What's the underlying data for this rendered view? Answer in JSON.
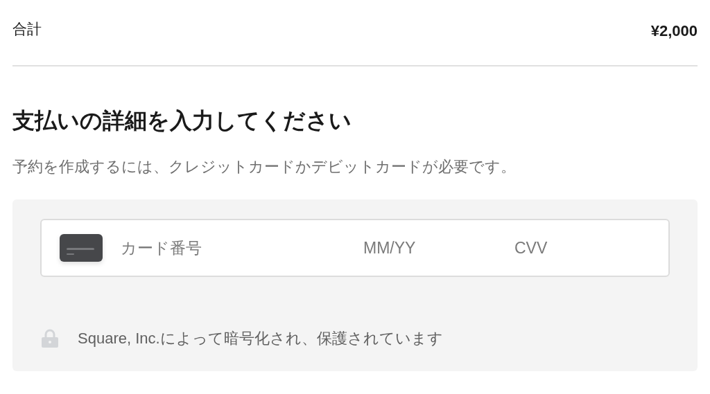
{
  "total": {
    "label": "合計",
    "amount": "¥2,000"
  },
  "heading": "支払いの詳細を入力してください",
  "description": "予約を作成するには、クレジットカードかデビットカードが必要です。",
  "card_form": {
    "fields": [
      {
        "kind": "card_number",
        "placeholder": "カード番号"
      },
      {
        "kind": "expiry",
        "placeholder": "MM/YY"
      },
      {
        "kind": "cvv",
        "placeholder": "CVV"
      }
    ]
  },
  "security_note": "Square, Inc.によって暗号化され、保護されています"
}
